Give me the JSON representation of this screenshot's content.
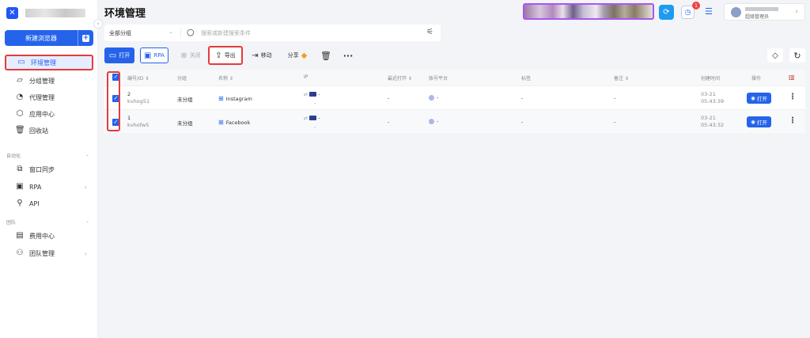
{
  "sidebar": {
    "new_browser": "新建浏览器",
    "items": [
      {
        "label": "环境管理",
        "icon": "browser-window-icon"
      },
      {
        "label": "分组管理",
        "icon": "folder-icon"
      },
      {
        "label": "代理管理",
        "icon": "proxy-icon"
      },
      {
        "label": "应用中心",
        "icon": "app-center-icon"
      },
      {
        "label": "回收站",
        "icon": "trash-icon"
      }
    ],
    "automation_title": "自动化",
    "automation_items": [
      {
        "label": "窗口同步",
        "icon": "sync-icon"
      },
      {
        "label": "RPA",
        "icon": "rpa-icon"
      },
      {
        "label": "API",
        "icon": "api-icon"
      }
    ],
    "team_title": "团队",
    "team_items": [
      {
        "label": "费用中心",
        "icon": "billing-icon"
      },
      {
        "label": "团队管理",
        "icon": "team-icon"
      }
    ]
  },
  "header": {
    "title": "环境管理",
    "notification_count": "1",
    "user_role": "超级管理员"
  },
  "filter": {
    "group_select": "全部分组",
    "search_placeholder": "搜索或新建搜索条件"
  },
  "toolbar": {
    "open": "打开",
    "rpa": "RPA",
    "close": "关闭",
    "export": "导出",
    "move": "移动",
    "share": "分享"
  },
  "table": {
    "headers": {
      "id": "编号/ID ⇕",
      "group": "分组",
      "name": "名称 ⇕",
      "ip": "IP",
      "last_open": "最近打开 ⇕",
      "account_platform": "账号平台",
      "tags": "标签",
      "remark": "备注 ⇕",
      "created": "创建时间",
      "actions": "操作"
    },
    "rows": [
      {
        "num": "2",
        "id": "kvhog51",
        "group": "未分组",
        "name": "Instagram",
        "ip": "-",
        "ip_sub": "-",
        "last_open": "-",
        "platform": "-",
        "tags": "-",
        "remark": "-",
        "date": "03-21",
        "time": "05:43:39",
        "action": "打开"
      },
      {
        "num": "1",
        "id": "kvhofw5",
        "group": "未分组",
        "name": "Facebook",
        "ip": "-",
        "ip_sub": "-",
        "last_open": "-",
        "platform": "-",
        "tags": "-",
        "remark": "-",
        "date": "03-21",
        "time": "05:43:32",
        "action": "打开"
      }
    ]
  },
  "colors": {
    "accent": "#2563eb",
    "highlight_border": "#e53b3b",
    "banner_border": "#a855f7"
  }
}
